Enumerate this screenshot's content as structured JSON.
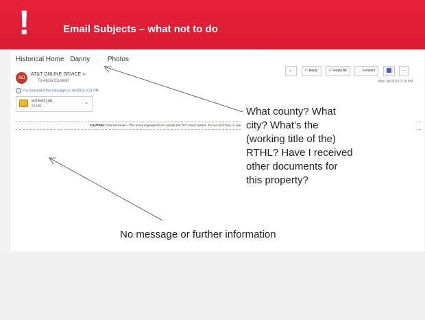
{
  "slide": {
    "title": "Email Subjects – what not to do",
    "bang": "!"
  },
  "email": {
    "tabs": [
      "Historical Home",
      "Danny",
      "Photos"
    ],
    "tab_blur": "…",
    "avatar_initials": "AO",
    "sender": "AT&T ONLINE SRVICE <",
    "recipient": "To  Alicia Costello",
    "forwarded": "You forwarded this message on 3/6/2023 4:21 PM.",
    "attachment": {
      "name": "archive(1).zip",
      "size": "23 MB"
    },
    "toolbar": {
      "reply": "Reply",
      "reply_all": "Reply All",
      "forward": "Forward"
    },
    "timestamp": "Mon 3/6/2023 3:10 PM",
    "caution": {
      "label": "CAUTION:",
      "text": "External Email – This email originated from outside the THC email system. Do not click links or open attachments unless you recognize the sender and know the content is safe."
    }
  },
  "annotations": {
    "callout_lines": [
      "What county? What",
      "city? What’s the",
      "(working title of the)",
      "RTHL? Have I received",
      "other documents for",
      "this property?"
    ],
    "no_message": "No message or further information"
  }
}
